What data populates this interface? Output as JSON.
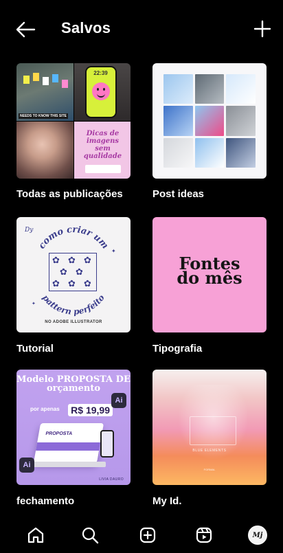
{
  "header": {
    "title": "Salvos",
    "back_icon": "arrow-left-icon",
    "add_icon": "plus-icon"
  },
  "collections": [
    {
      "name": "Todas as publicações",
      "cover_texts": {
        "caption": "NEEDS TO KNOW THIS SITE",
        "phone_time": "22:39",
        "pink_title": "Dicas de imagens sem qualidade"
      }
    },
    {
      "name": "Post ideas"
    },
    {
      "name": "Tutorial",
      "cover_texts": {
        "monogram": "Dy",
        "arc_top": "como criar um",
        "arc_bottom": "pattern perfeito",
        "footer": "NO ADOBE ILLUSTRATOR"
      }
    },
    {
      "name": "Tipografia",
      "cover_texts": {
        "line1": "Fontes",
        "line2": "do mês"
      }
    },
    {
      "name": "fechamento",
      "cover_texts": {
        "title": "Modelo PROPOSTA DE orçamento",
        "price_prefix": "por apenas",
        "price": "R$ 19,99",
        "laptop_title": "PROPOSTA",
        "badge": "Ai",
        "signature": "LIVIA DAURO"
      }
    },
    {
      "name": "My Id.",
      "cover_texts": {
        "caption": "BLUE ELEMENTS",
        "mini": "FORMAL"
      }
    }
  ],
  "bottom_nav": [
    {
      "name": "home",
      "icon": "home-icon"
    },
    {
      "name": "search",
      "icon": "search-icon"
    },
    {
      "name": "create",
      "icon": "plus-square-icon"
    },
    {
      "name": "reels",
      "icon": "reels-icon"
    },
    {
      "name": "profile",
      "icon": "avatar",
      "monogram": "Mj"
    }
  ],
  "colors": {
    "background": "#000000",
    "text": "#ffffff",
    "tutorial_ink": "#3b3d8c",
    "tipografia_bg": "#f7a1d6",
    "fechamento_bg": "#b698ea"
  }
}
